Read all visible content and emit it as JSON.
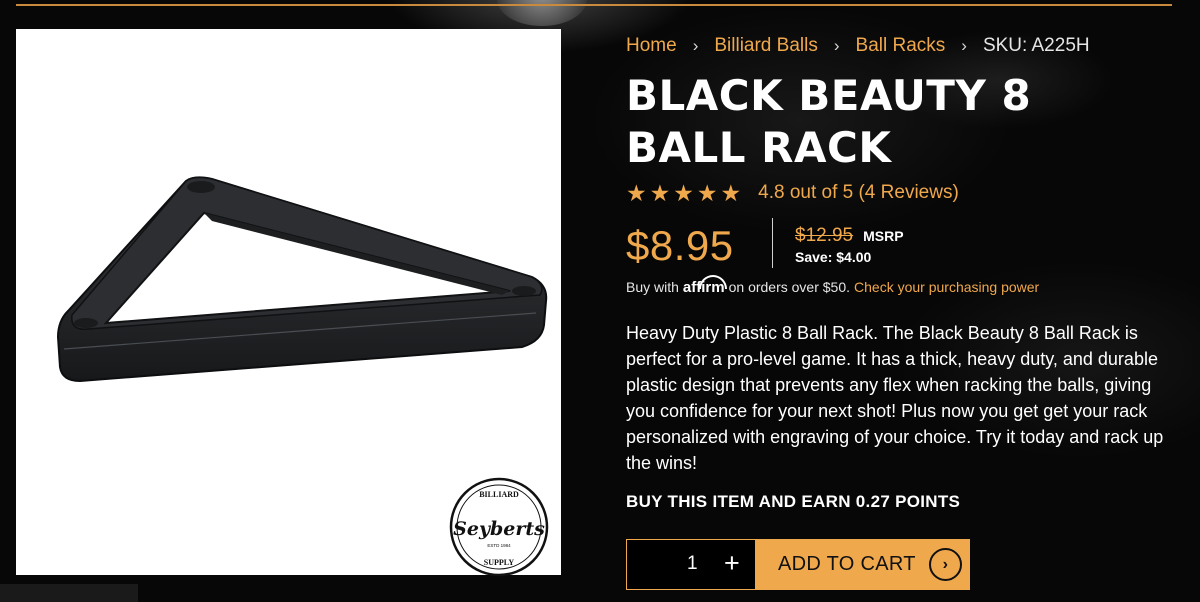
{
  "breadcrumb": {
    "items": [
      "Home",
      "Billiard Balls",
      "Ball Racks"
    ],
    "current": "SKU: A225H",
    "separator": ">"
  },
  "product": {
    "title": "Black Beauty 8 Ball Rack",
    "rating": {
      "stars": 5,
      "text": "4.8 out of 5 (4 Reviews)",
      "value": 4.8,
      "count": 4
    },
    "price": "$8.95",
    "msrp_price": "$12.95",
    "msrp_label": "MSRP",
    "save_text": "Save: $4.00",
    "affirm": {
      "prefix": "Buy with",
      "logo_text": "affirm",
      "suffix": "on orders over $50.",
      "link": "Check your purchasing power"
    },
    "description": "Heavy Duty Plastic 8 Ball Rack. The Black Beauty 8 Ball Rack is perfect for a pro-level game. It has a thick, heavy duty, and durable plastic design that prevents any flex when racking the balls, giving you confidence for your next shot! Plus now you get get your rack personalized with engraving of your choice. Try it today and rack up the wins!",
    "points": "BUY THIS ITEM AND EARN 0.27 POINTS",
    "quantity": "1",
    "add_to_cart": "ADD TO CART"
  },
  "brand": {
    "logo_top": "BILLIARD",
    "logo_name": "Seyberts",
    "logo_est": "ESTD 1984",
    "logo_bottom": "SUPPLY"
  },
  "colors": {
    "accent": "#f0a84c",
    "background": "#070707",
    "text": "#ffffff"
  },
  "icons": {
    "star": "star-icon",
    "breadcrumb_separator": "chevron-right-icon",
    "plus": "plus-icon",
    "cart_arrow": "arrow-right-circle-icon"
  }
}
